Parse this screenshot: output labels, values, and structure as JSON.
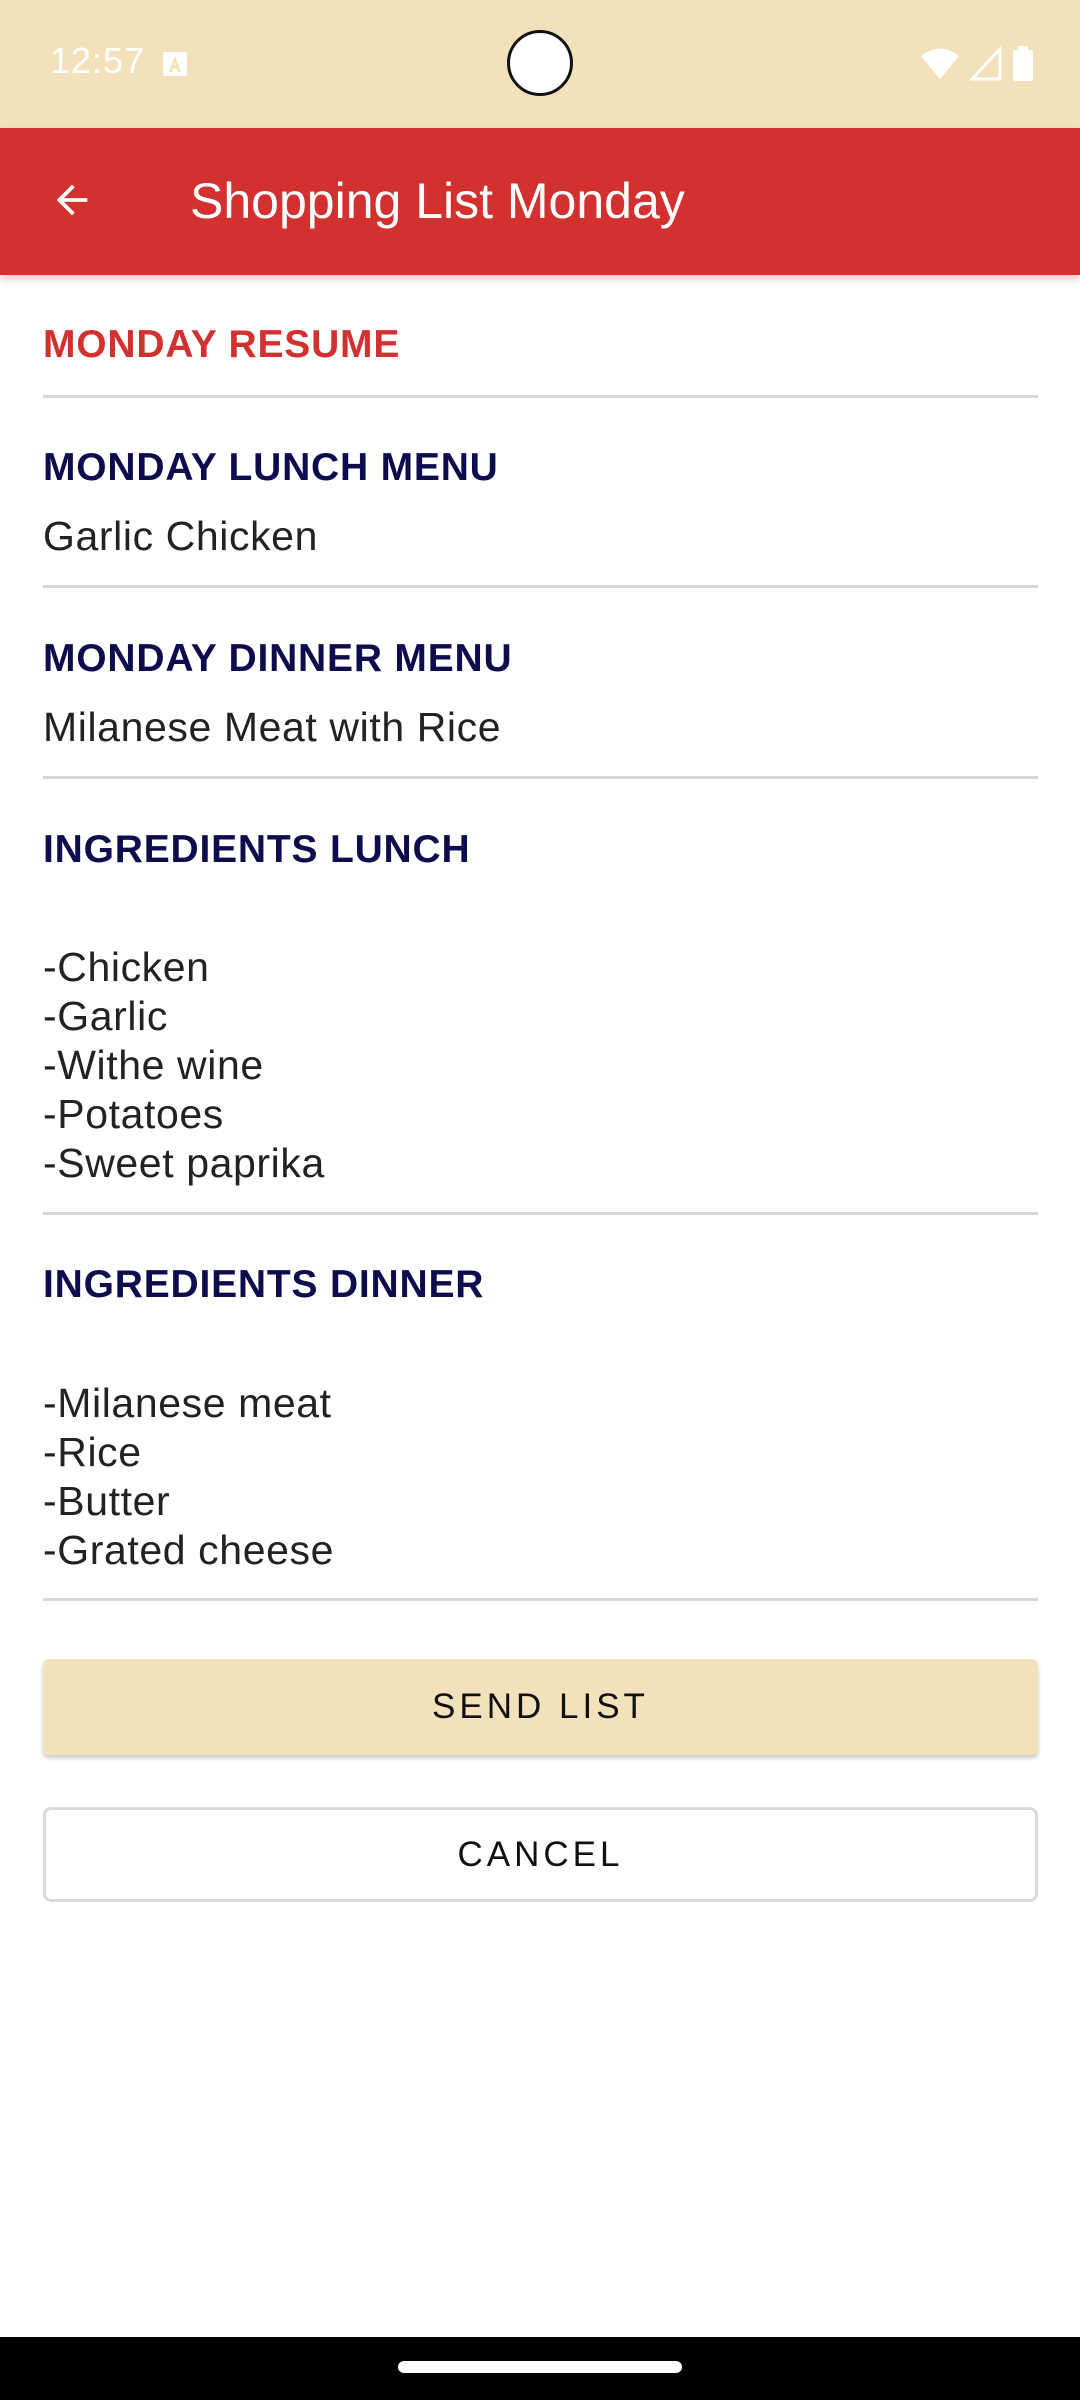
{
  "status_bar": {
    "time": "12:57"
  },
  "app_bar": {
    "title": "Shopping List Monday"
  },
  "resume": {
    "header": "MONDAY RESUME"
  },
  "lunch_menu": {
    "header": "MONDAY LUNCH MENU",
    "value": "Garlic Chicken"
  },
  "dinner_menu": {
    "header": "MONDAY DINNER MENU",
    "value": "Milanese Meat with Rice"
  },
  "ingredients_lunch": {
    "header": "INGREDIENTS LUNCH",
    "items": [
      "-Chicken",
      "-Garlic",
      "-Withe wine",
      "-Potatoes",
      "-Sweet paprika"
    ]
  },
  "ingredients_dinner": {
    "header": "INGREDIENTS DINNER",
    "items": [
      "-Milanese meat",
      "-Rice",
      "-Butter",
      "-Grated cheese"
    ]
  },
  "actions": {
    "send_label": "SEND LIST",
    "cancel_label": "CANCEL"
  },
  "colors": {
    "status_bar": "#f3e1bb",
    "app_bar": "#d33030",
    "resume_header": "#d33030",
    "section_header": "#0d0d4d",
    "send_button": "#f3e1bb"
  }
}
